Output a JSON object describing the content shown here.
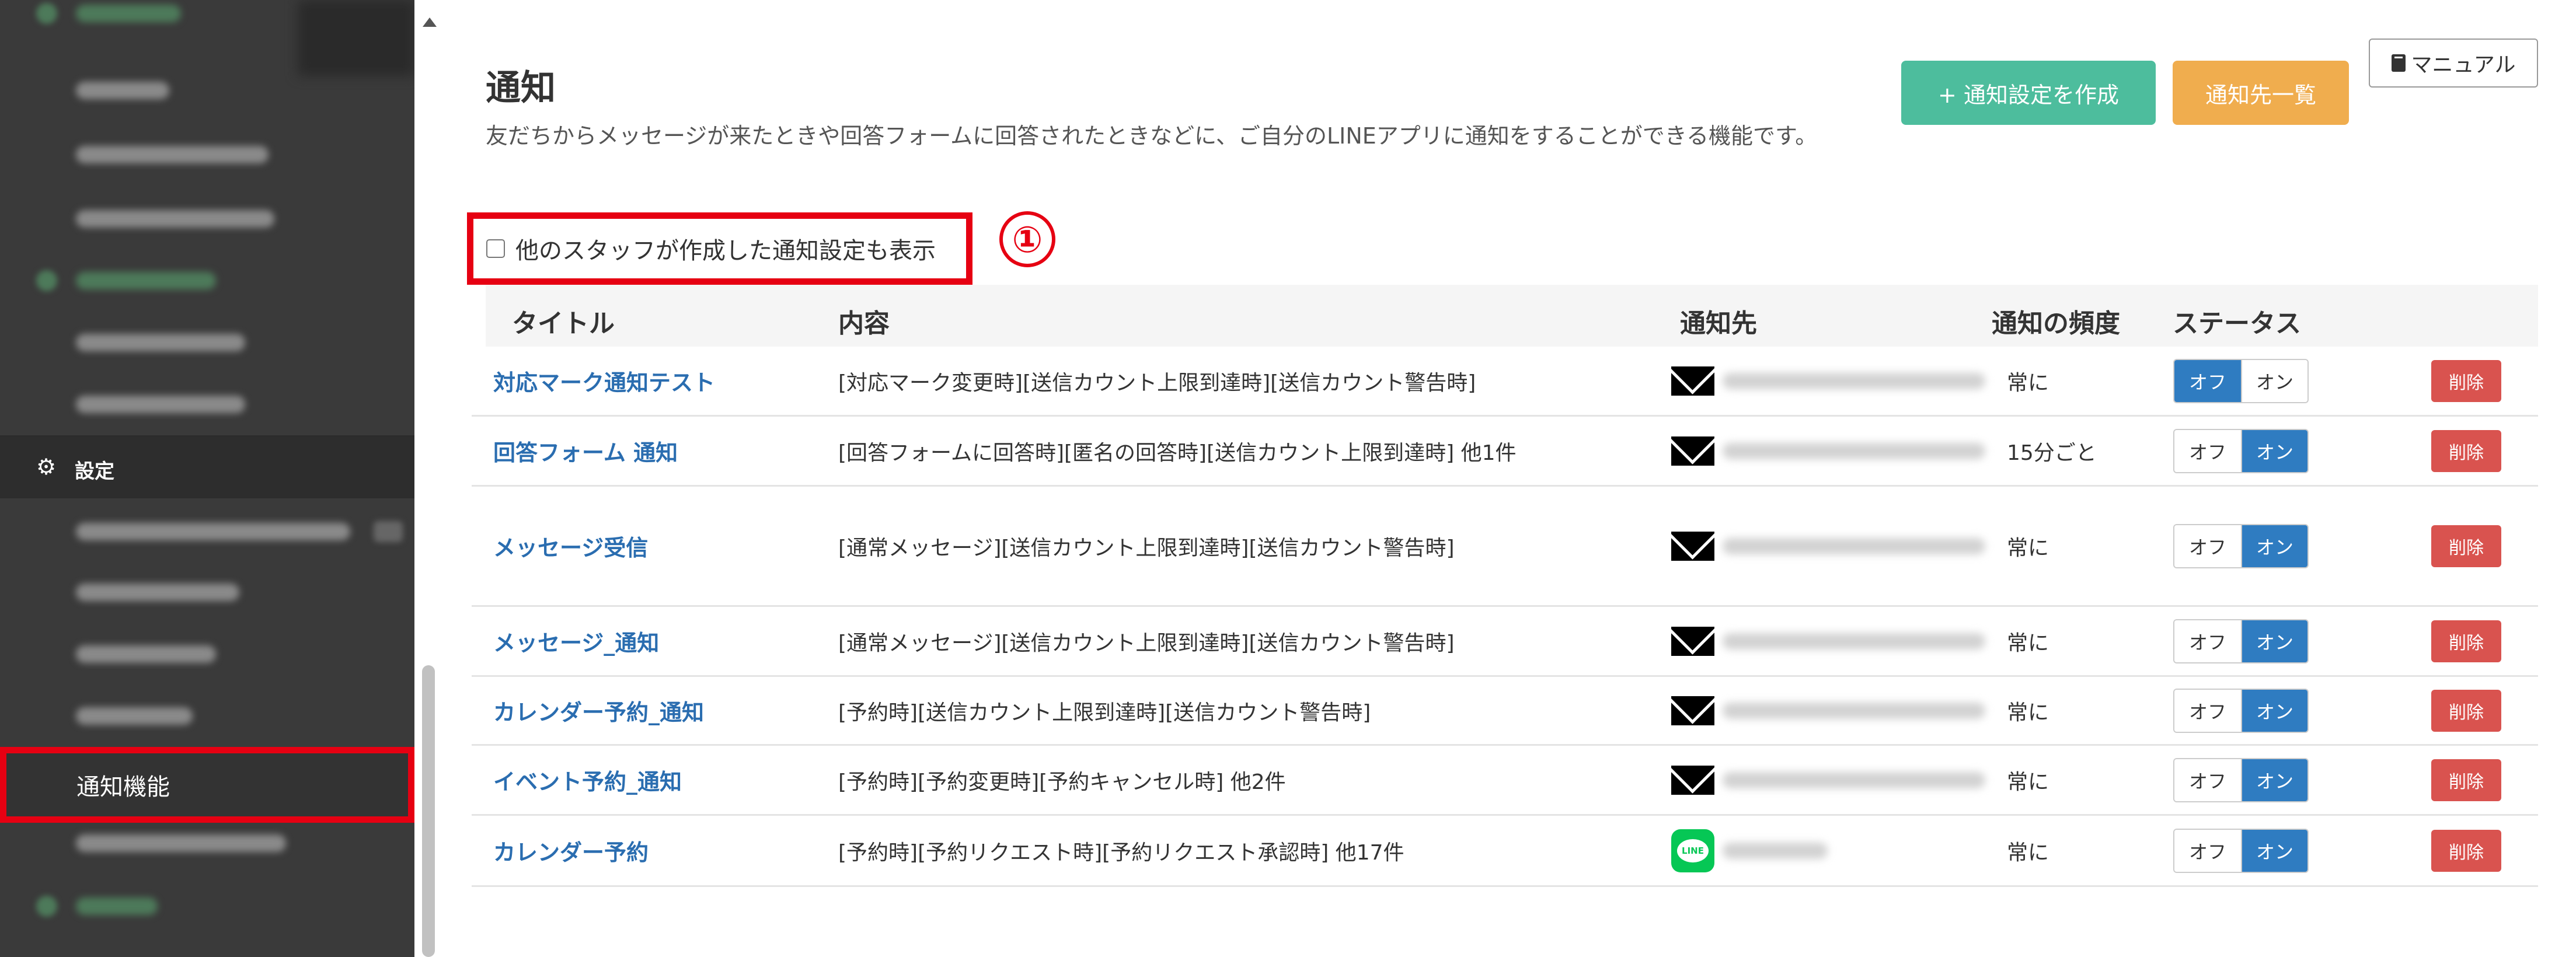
{
  "sidebar": {
    "settings_label": "設定",
    "active_item": "通知機能"
  },
  "header": {
    "title": "通知",
    "description": "友だちからメッセージが来たときや回答フォームに回答されたときなどに、ご自分のLINEアプリに通知をすることができる機能です。",
    "create_button": "+ 通知設定を作成",
    "list_button": "通知先一覧",
    "manual_button": "マニュアル"
  },
  "filter": {
    "checkbox_label": "他のスタッフが作成した通知設定も表示",
    "annotation": "①"
  },
  "table": {
    "headers": {
      "title": "タイトル",
      "content": "内容",
      "destination": "通知先",
      "frequency": "通知の頻度",
      "status": "ステータス"
    },
    "off_label": "オフ",
    "on_label": "オン",
    "delete_label": "削除",
    "line_icon_text": "LINE",
    "rows": [
      {
        "title": "対応マーク通知テスト",
        "content": "[対応マーク変更時][送信カウント上限到達時][送信カウント警告時]",
        "destination_type": "mail",
        "frequency": "常に",
        "status": "off"
      },
      {
        "title": "回答フォーム 通知",
        "content": "[回答フォームに回答時][匿名の回答時][送信カウント上限到達時] 他1件",
        "destination_type": "mail",
        "frequency": "15分ごと",
        "status": "on"
      },
      {
        "title": "メッセージ受信",
        "content": "[通常メッセージ][送信カウント上限到達時][送信カウント警告時]",
        "destination_type": "mail",
        "frequency": "常に",
        "status": "on"
      },
      {
        "title": "メッセージ_通知",
        "content": "[通常メッセージ][送信カウント上限到達時][送信カウント警告時]",
        "destination_type": "mail",
        "frequency": "常に",
        "status": "on"
      },
      {
        "title": "カレンダー予約_通知",
        "content": "[予約時][送信カウント上限到達時][送信カウント警告時]",
        "destination_type": "mail",
        "frequency": "常に",
        "status": "on"
      },
      {
        "title": "イベント予約_通知",
        "content": "[予約時][予約変更時][予約キャンセル時] 他2件",
        "destination_type": "mail",
        "frequency": "常に",
        "status": "on"
      },
      {
        "title": "カレンダー予約",
        "content": "[予約時][予約リクエスト時][予約リクエスト承認時] 他17件",
        "destination_type": "line",
        "frequency": "常に",
        "status": "on"
      }
    ]
  },
  "colors": {
    "sidebar_bg": "#3a3a3a",
    "primary_green": "#4dbd9d",
    "warning_orange": "#f0ad4e",
    "toggle_on_blue": "#2f7cc1",
    "delete_red": "#d9534f",
    "link_blue": "#2a6db0",
    "highlight_red": "#e60012"
  },
  "icons": {
    "settings": "gear-icon",
    "manual": "book-icon",
    "mail": "mail-icon",
    "line": "line-icon",
    "scroll_up": "caret-up-icon"
  }
}
